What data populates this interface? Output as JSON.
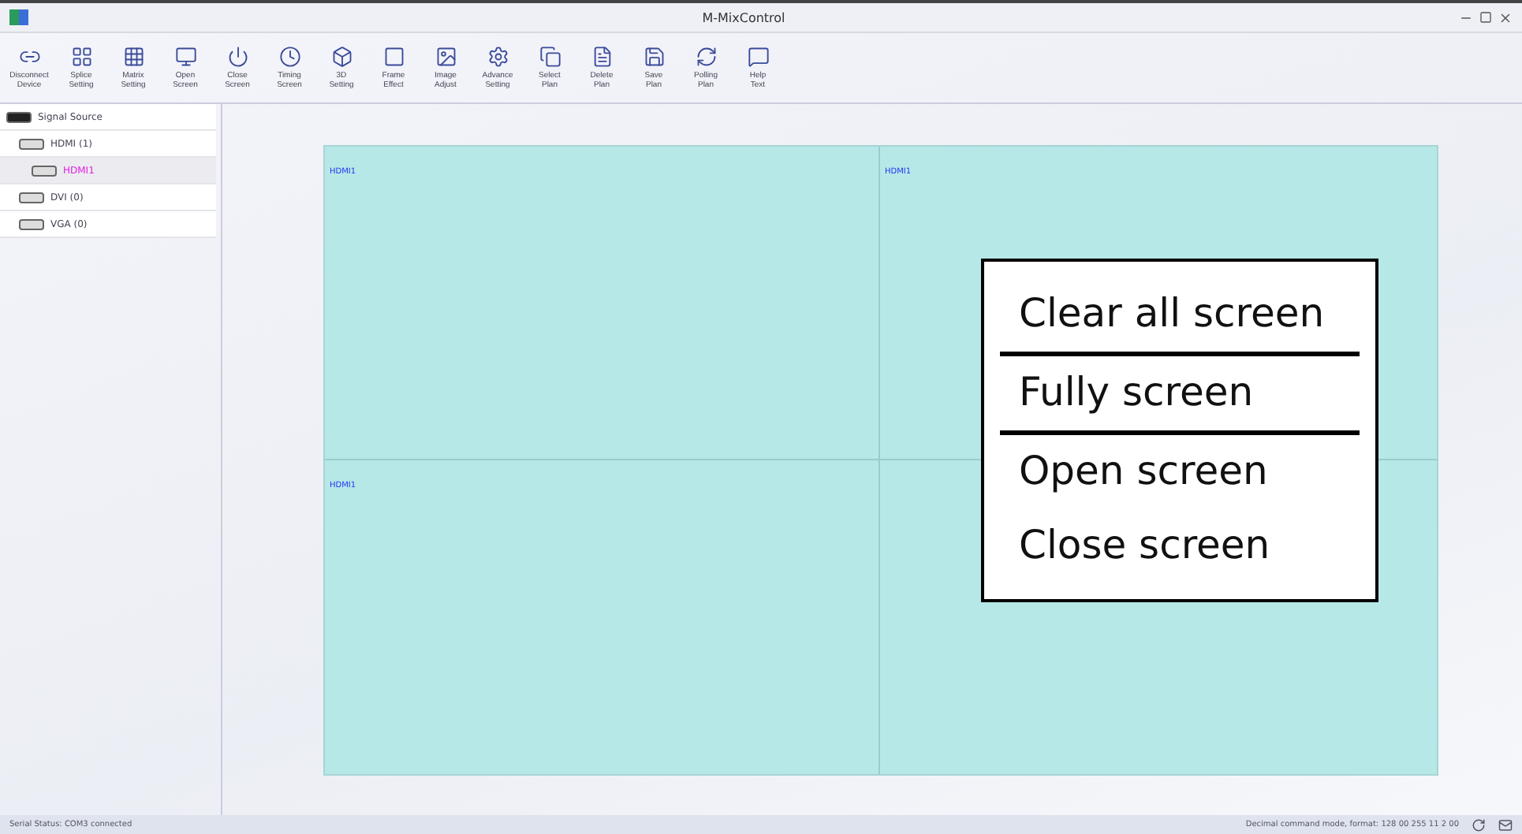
{
  "window": {
    "title": "M-MixControl"
  },
  "toolbar": [
    {
      "label": "Disconnect\nDevice",
      "kind": "link"
    },
    {
      "label": "Splice\nSetting",
      "kind": "grid"
    },
    {
      "label": "Matrix\nSetting",
      "kind": "matrix"
    },
    {
      "label": "Open\nScreen",
      "kind": "monitor"
    },
    {
      "label": "Close\nScreen",
      "kind": "power"
    },
    {
      "label": "Timing\nScreen",
      "kind": "clock"
    },
    {
      "label": "3D\nSetting",
      "kind": "cube"
    },
    {
      "label": "Frame\nEffect",
      "kind": "square"
    },
    {
      "label": "Image\nAdjust",
      "kind": "image"
    },
    {
      "label": "Advance\nSetting",
      "kind": "gear"
    },
    {
      "label": "Select\nPlan",
      "kind": "copy"
    },
    {
      "label": "Delete\nPlan",
      "kind": "file"
    },
    {
      "label": "Save\nPlan",
      "kind": "save"
    },
    {
      "label": "Polling\nPlan",
      "kind": "refresh"
    },
    {
      "label": "Help\nText",
      "kind": "help"
    }
  ],
  "sidebar": {
    "items": [
      {
        "label": "Signal Source",
        "selected": false,
        "children": [
          {
            "label": "HDMI (1)",
            "selected": false,
            "children": [
              {
                "label": "HDMI1",
                "selected": true
              }
            ]
          },
          {
            "label": "DVI (0)",
            "selected": false
          },
          {
            "label": "VGA (0)",
            "selected": false
          }
        ]
      }
    ]
  },
  "screens": [
    {
      "label": "HDMI1"
    },
    {
      "label": "HDMI1"
    },
    {
      "label": "HDMI1"
    }
  ],
  "context_menu": [
    {
      "label": "Clear all screen",
      "separator_after": true
    },
    {
      "label": "Fully screen",
      "separator_after": true
    },
    {
      "label": "Open screen",
      "separator_after": false
    },
    {
      "label": "Close screen",
      "separator_after": false
    }
  ],
  "status_bar": {
    "left": "Serial Status: COM3 connected",
    "right": "Decimal command mode, format: 128 00 255 11 2 00"
  }
}
